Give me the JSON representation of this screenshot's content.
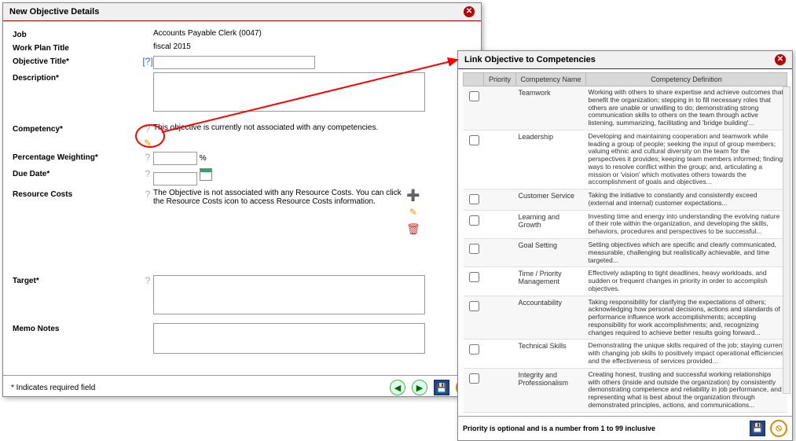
{
  "main": {
    "title": "New Objective Details",
    "rows": {
      "job_label": "Job",
      "job_value": "Accounts Payable Clerk (0047)",
      "workplan_label": "Work Plan Title",
      "workplan_value": "fiscal 2015",
      "objtitle_label": "Objective Title*",
      "objtitle_help": "[?]",
      "desc_label": "Description*",
      "competency_label": "Competency*",
      "competency_text": "This objective is currently not associated with any competencies.",
      "pct_label": "Percentage Weighting*",
      "pct_suffix": "%",
      "due_label": "Due Date*",
      "resource_label": "Resource Costs",
      "resource_text": "The Objective is not associated with any Resource Costs. You can click the Resource Costs icon to access Resource Costs information.",
      "target_label": "Target*",
      "memo_label": "Memo Notes"
    },
    "footer_note": "* Indicates required field"
  },
  "link": {
    "title": "Link Objective to Competencies",
    "cols": {
      "priority": "Priority",
      "name": "Competency Name",
      "def": "Competency Definition"
    },
    "rows": [
      {
        "name": "Teamwork",
        "def": "Working with others to share expertise and achieve outcomes that benefit the organization; stepping in to fill necessary roles that others are unable or unwilling to do; demonstrating strong communication skills to others on the team through active listening, summarizing, facilitating and 'bridge building'..."
      },
      {
        "name": "Leadership",
        "def": "Developing and maintaining cooperation and teamwork while leading a group of people; seeking the input of group members; valuing ethnic and cultural diversity on the team for the perspectives it provides; keeping team members informed; finding ways to resolve conflict within the group; and, articulating a mission or 'vision' which motivates others towards the accomplishment of goals and objectives..."
      },
      {
        "name": "Customer Service",
        "def": "Taking the initiative to constantly and consistently exceed (external and internal) customer expectations..."
      },
      {
        "name": "Learning and Growth",
        "def": "Investing time and energy into understanding the evolving nature of their role within the organization, and developing the skills, behaviors, procedures and perspectives to be successful..."
      },
      {
        "name": "Goal Setting",
        "def": "Setting objectives which are specific and clearly communicated, measurable, challenging but realistically achievable, and time targeted..."
      },
      {
        "name": "Time / Priority Management",
        "def": "Effectively adapting to tight deadlines, heavy workloads, and sudden or frequent changes in priority in order to accomplish objectives."
      },
      {
        "name": "Accountability",
        "def": "Taking responsibility for clarifying the expectations of others; acknowledging how personal decisions, actions and standards of performance influence work accomplishments; accepting responsibility for work accomplishments; and, recognizing changes required to achieve better results going forward..."
      },
      {
        "name": "Technical Skills",
        "def": "Demonstrating the unique skills required of the job; staying current with changing job skills to positively impact operational efficiencies and the effectiveness of services provided..."
      },
      {
        "name": "Integrity and Professionalism",
        "def": "Creating honest, trusting and successful working relationships with others (inside and outside the organization) by consistently demonstrating competence and reliability in job performance, and representing what is best about the organization through demonstrated principles, actions, and communications..."
      }
    ],
    "footer_note": "Priority is optional and is a number from 1 to 99 inclusive"
  }
}
